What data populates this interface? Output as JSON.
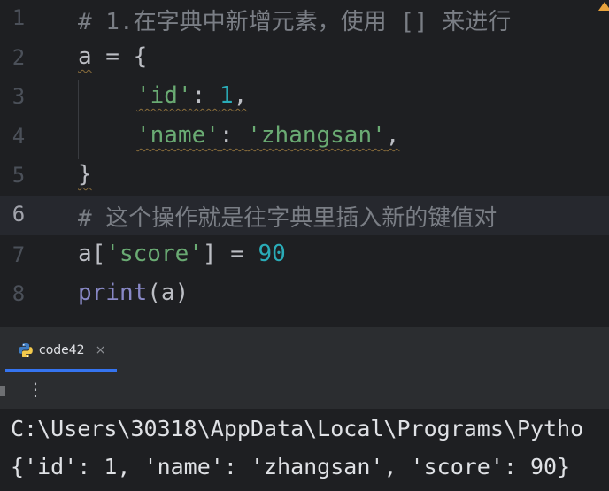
{
  "editor": {
    "lines": [
      {
        "n": "1",
        "comment": "# 1.在字典中新增元素，使用 [] 来进行"
      },
      {
        "n": "2",
        "a": "a",
        "eq": " = ",
        "brace": "{"
      },
      {
        "n": "3",
        "key": "'id'",
        "colon": ": ",
        "val": "1",
        "comma": ","
      },
      {
        "n": "4",
        "key": "'name'",
        "colon": ": ",
        "val": "'zhangsan'",
        "comma": ","
      },
      {
        "n": "5",
        "brace": "}"
      },
      {
        "n": "6",
        "comment": "# 这个操作就是往字典里插入新的键值对"
      },
      {
        "n": "7",
        "a": "a",
        "lb": "[",
        "key": "'score'",
        "rb": "]",
        "eq": " = ",
        "val": "90"
      },
      {
        "n": "8",
        "fn": "print",
        "args": "(a)"
      }
    ],
    "current_line": 6,
    "warning_color": "#e8a33d"
  },
  "run_panel": {
    "tab_label": "code42",
    "tab_close": "×",
    "tab_icon": "python-icon",
    "more_icon": "⋮",
    "console_lines": [
      "C:\\Users\\30318\\AppData\\Local\\Programs\\Pytho",
      "{'id': 1, 'name': 'zhangsan', 'score': 90}"
    ]
  },
  "colors": {
    "background": "#1e1f22",
    "string": "#6aab73",
    "number": "#2aacb8",
    "comment": "#7a7e85",
    "builtin": "#8888c6",
    "accent": "#3574f0"
  }
}
